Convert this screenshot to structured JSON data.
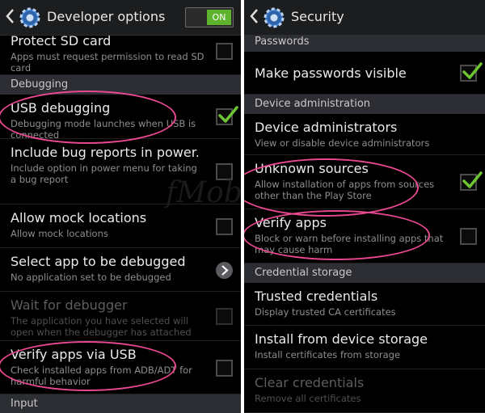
{
  "left_panel": {
    "title": "Developer options",
    "toggle_label": "ON",
    "items": [
      {
        "kind": "item",
        "title": "Protect SD card",
        "sub": "Apps must request permission to read SD card",
        "control": "checkbox",
        "checked": false
      },
      {
        "kind": "section",
        "label": "Debugging"
      },
      {
        "kind": "item",
        "title": "USB debugging",
        "sub": "Debugging mode launches when USB is connected",
        "control": "checkbox",
        "checked": true
      },
      {
        "kind": "item",
        "title": "Include bug reports in power..",
        "sub": "Include option in power menu for taking a bug report",
        "control": "checkbox",
        "checked": false
      },
      {
        "kind": "item",
        "title": "Allow mock locations",
        "sub": "Allow mock locations",
        "control": "checkbox",
        "checked": false
      },
      {
        "kind": "item",
        "title": "Select app to be debugged",
        "sub": "No application set to be debugged",
        "control": "arrow"
      },
      {
        "kind": "item",
        "title": "Wait for debugger",
        "sub": "The application you have selected will open when the debugger has attached",
        "control": "checkbox",
        "checked": false,
        "disabled": true
      },
      {
        "kind": "item",
        "title": "Verify apps via USB",
        "sub": "Check installed apps from ADB/ADT for harmful behavior",
        "control": "checkbox",
        "checked": false
      },
      {
        "kind": "section",
        "label": "Input"
      }
    ]
  },
  "right_panel": {
    "title": "Security",
    "items": [
      {
        "kind": "section",
        "label": "Passwords"
      },
      {
        "kind": "item",
        "title": "Make passwords visible",
        "control": "checkbox",
        "checked": true
      },
      {
        "kind": "section",
        "label": "Device administration"
      },
      {
        "kind": "item",
        "title": "Device administrators",
        "sub": "View or disable device administrators",
        "control": "none"
      },
      {
        "kind": "item",
        "title": "Unknown sources",
        "sub": "Allow installation of apps from sources other than the Play Store",
        "control": "checkbox",
        "checked": true
      },
      {
        "kind": "item",
        "title": "Verify apps",
        "sub": "Block or warn before installing apps that may cause harm",
        "control": "checkbox",
        "checked": false
      },
      {
        "kind": "section",
        "label": "Credential storage"
      },
      {
        "kind": "item",
        "title": "Trusted credentials",
        "sub": "Display trusted CA certificates",
        "control": "none"
      },
      {
        "kind": "item",
        "title": "Install from device storage",
        "sub": "Install certificates from storage",
        "control": "none"
      },
      {
        "kind": "item",
        "title": "Clear credentials",
        "sub": "Remove all certificates",
        "control": "none",
        "disabled": true
      }
    ]
  },
  "watermark": "fMob",
  "colors": {
    "accent": "#5fb32c",
    "highlight": "#e7488f",
    "section_bg": "#2c2e33",
    "actionbar_bg": "#1c1d1f"
  }
}
